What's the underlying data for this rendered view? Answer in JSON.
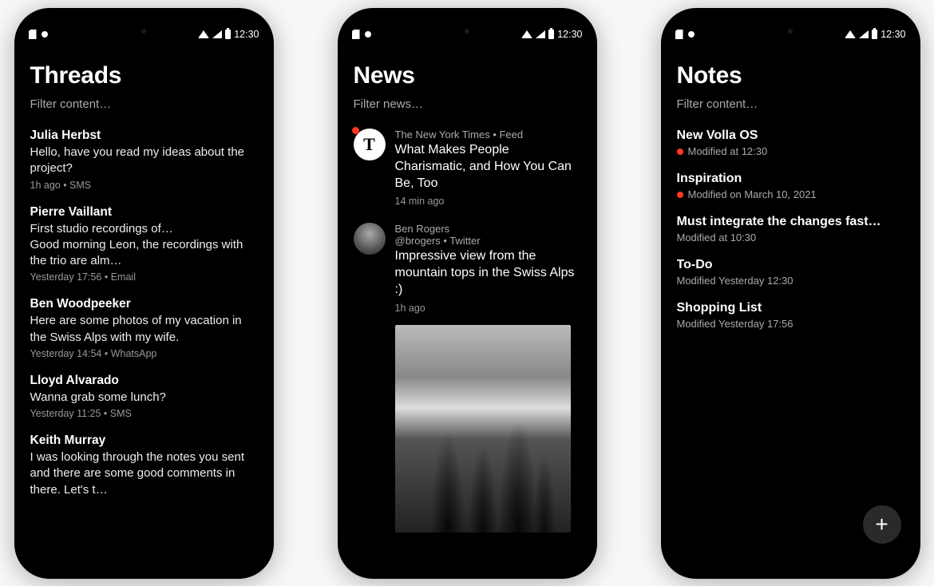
{
  "status": {
    "time": "12:30"
  },
  "threads": {
    "title": "Threads",
    "filter_placeholder": "Filter content…",
    "items": [
      {
        "name": "Julia Herbst",
        "preview": "Hello, have you read my ideas about the project?",
        "meta": "1h ago • SMS"
      },
      {
        "name": "Pierre Vaillant",
        "preview": "First studio recordings of…\nGood morning Leon, the recordings with the trio are alm…",
        "meta": "Yesterday 17:56 • Email"
      },
      {
        "name": "Ben Woodpeeker",
        "preview": "Here are some photos of my vacation in the Swiss Alps with my wife.",
        "meta": "Yesterday 14:54 • WhatsApp"
      },
      {
        "name": "Lloyd Alvarado",
        "preview": "Wanna grab some lunch?",
        "meta": "Yesterday 11:25 • SMS"
      },
      {
        "name": "Keith Murray",
        "preview": "I was looking through the notes you sent and there are some good comments in there. Let's t…",
        "meta": ""
      }
    ]
  },
  "news": {
    "title": "News",
    "filter_placeholder": "Filter news…",
    "items": [
      {
        "avatar_glyph": "T",
        "unread": true,
        "source": "The New York Times • Feed",
        "headline": "What Makes People Charismatic, and How You Can Be, Too",
        "time": "14 min ago"
      },
      {
        "avatar_glyph": "",
        "unread": false,
        "source": "Ben Rogers\n@brogers • Twitter",
        "headline": "Impressive view from the mountain tops in the Swiss Alps :)",
        "time": "1h ago",
        "has_image": true
      }
    ]
  },
  "notes": {
    "title": "Notes",
    "filter_placeholder": "Filter content…",
    "items": [
      {
        "title": "New Volla OS",
        "meta": "Modified at 12:30",
        "unread": true
      },
      {
        "title": "Inspiration",
        "meta": "Modified on March 10, 2021",
        "unread": true
      },
      {
        "title": "Must integrate the changes fast…",
        "meta": "Modified at 10:30",
        "unread": false
      },
      {
        "title": "To-Do",
        "meta": "Modified Yesterday 12:30",
        "unread": false
      },
      {
        "title": "Shopping List",
        "meta": "Modified Yesterday 17:56",
        "unread": false
      }
    ],
    "fab_label": "+"
  }
}
